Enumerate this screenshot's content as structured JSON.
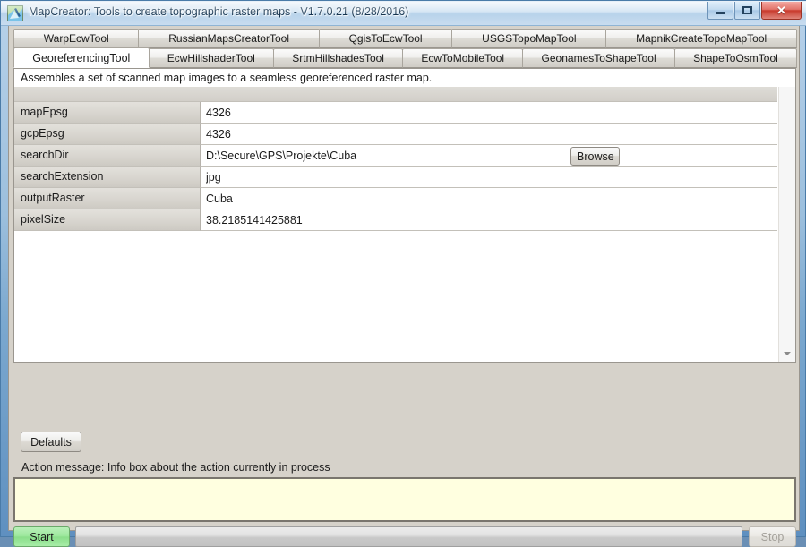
{
  "window": {
    "title": "MapCreator: Tools to create topographic raster maps - V1.7.0.21 (8/28/2016)",
    "icon": "map-app-icon",
    "controls": {
      "minimize": "minimize-icon",
      "maximize": "maximize-icon",
      "close": "✕"
    },
    "accent_color": "#2e6da4",
    "frame_color": "#7ba8cf"
  },
  "tabs": {
    "row1": [
      {
        "label": "WarpEcwTool",
        "selected": false
      },
      {
        "label": "RussianMapsCreatorTool",
        "selected": false
      },
      {
        "label": "QgisToEcwTool",
        "selected": false
      },
      {
        "label": "USGSTopoMapTool",
        "selected": false
      },
      {
        "label": "MapnikCreateTopoMapTool",
        "selected": false
      }
    ],
    "row2": [
      {
        "label": "GeoreferencingTool",
        "selected": true
      },
      {
        "label": "EcwHillshaderTool",
        "selected": false
      },
      {
        "label": "SrtmHillshadesTool",
        "selected": false
      },
      {
        "label": "EcwToMobileTool",
        "selected": false
      },
      {
        "label": "GeonamesToShapeTool",
        "selected": false
      },
      {
        "label": "ShapeToOsmTool",
        "selected": false
      }
    ]
  },
  "page": {
    "description": "Assembles a set of scanned map images to a seamless georeferenced raster map.",
    "properties": [
      {
        "name": "mapEpsg",
        "value": "4326",
        "browse": false
      },
      {
        "name": "gcpEpsg",
        "value": "4326",
        "browse": false
      },
      {
        "name": "searchDir",
        "value": "D:\\Secure\\GPS\\Projekte\\Cuba",
        "browse": true
      },
      {
        "name": "searchExtension",
        "value": "jpg",
        "browse": false
      },
      {
        "name": "outputRaster",
        "value": "Cuba",
        "browse": false
      },
      {
        "name": "pixelSize",
        "value": "38.2185141425881",
        "browse": false
      }
    ],
    "browse_label": "Browse",
    "scroll_down_icon": "chevron-down-icon"
  },
  "footer": {
    "defaults_label": "Defaults",
    "action_message": "Action message: Info box about the action currently in process",
    "log_text": "",
    "log_background": "#ffffe0",
    "start_label": "Start",
    "start_color": "#9ee89e",
    "stop_label": "Stop",
    "stop_enabled": false,
    "progress_percent": 0
  }
}
